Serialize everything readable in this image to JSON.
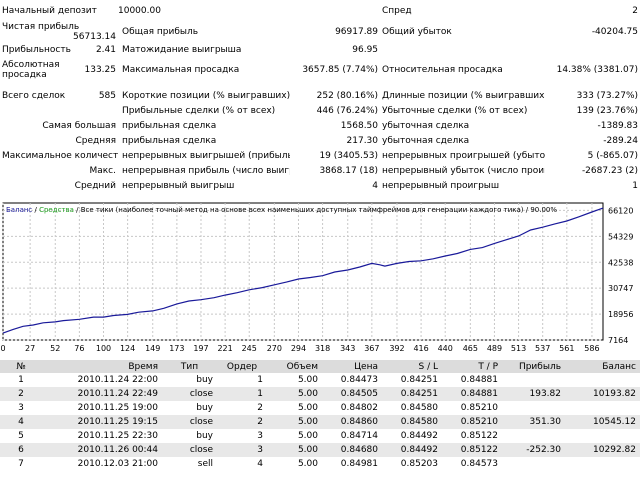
{
  "summary": {
    "initial_deposit_label": "Начальный депозит",
    "initial_deposit_value": "10000.00",
    "spread_label": "Спред",
    "spread_value": "2",
    "net_profit_label": "Чистая прибыль",
    "net_profit_value": "56713.14",
    "gross_profit_label": "Общая прибыль",
    "gross_profit_value": "96917.89",
    "gross_loss_label": "Общий убыток",
    "gross_loss_value": "-40204.75",
    "profit_factor_label": "Прибыльность",
    "profit_factor_value": "2.41",
    "expected_payoff_label": "Матожидание выигрыша",
    "expected_payoff_value": "96.95",
    "abs_drawdown_label": "Абсолютная просадка",
    "abs_drawdown_value": "133.25",
    "max_drawdown_label": "Максимальная просадка",
    "max_drawdown_value": "3657.85 (7.74%)",
    "rel_drawdown_label": "Относительная просадка",
    "rel_drawdown_value": "14.38% (3381.07)",
    "total_trades_label": "Всего сделок",
    "total_trades_value": "585",
    "short_label": "Короткие позиции (% выигравших)",
    "short_value": "252 (80.16%)",
    "long_label": "Длинные позиции (% выигравших)",
    "long_value": "333 (73.27%)",
    "profit_trades_label": "Прибыльные сделки (% от всех)",
    "profit_trades_value": "446 (76.24%)",
    "loss_trades_label": "Убыточные сделки (% от всех)",
    "loss_trades_value": "139 (23.76%)",
    "largest_label": "Самая большая",
    "largest_profit_label": "прибыльная сделка",
    "largest_profit_value": "1568.50",
    "largest_loss_label": "убыточная сделка",
    "largest_loss_value": "-1389.83",
    "average_label": "Средняя",
    "average_profit_label": "прибыльная сделка",
    "average_profit_value": "217.30",
    "average_loss_label": "убыточная сделка",
    "average_loss_value": "-289.24",
    "max_count_label": "Максимальное количество",
    "max_cons_wins_label": "непрерывных выигрышей (прибыль)",
    "max_cons_wins_value": "19 (3405.53)",
    "max_cons_losses_label": "непрерывных проигрышей (убыток)",
    "max_cons_losses_value": "5 (-865.07)",
    "max_label": "Макс.",
    "max_cons_profit_label": "непрерывная прибыль (число выигрышей)",
    "max_cons_profit_value": "3868.17 (18)",
    "max_cons_loss_label": "непрерывный убыток (число проигрышей)",
    "max_cons_loss_value": "-2687.23 (2)",
    "avg_label": "Средний",
    "avg_cons_wins_label": "непрерывный выигрыш",
    "avg_cons_wins_value": "4",
    "avg_cons_losses_label": "непрерывный проигрыш",
    "avg_cons_losses_value": "1"
  },
  "chart_data": {
    "type": "line",
    "legend": {
      "balance": "Баланс",
      "sep1": " / ",
      "equity": "Средства",
      "sep2": " / ",
      "desc": "Все тики (наиболее точный метод на основе всех наименьших доступных таймфреймов для генерации каждого тика)",
      "sep3": " / ",
      "quality": "90.00%"
    },
    "x_ticks": [
      "0",
      "27",
      "52",
      "76",
      "100",
      "124",
      "149",
      "173",
      "197",
      "221",
      "245",
      "270",
      "294",
      "318",
      "343",
      "367",
      "392",
      "416",
      "440",
      "465",
      "489",
      "513",
      "537",
      "561",
      "586"
    ],
    "y_ticks": [
      "66120",
      "54329",
      "42538",
      "30747",
      "18956",
      "7164"
    ],
    "xlim": [
      0,
      597
    ],
    "ylim": [
      7164,
      69500
    ],
    "series": [
      {
        "name": "Баланс",
        "color": "#1a1a9a",
        "x": [
          0,
          10,
          20,
          30,
          40,
          52,
          60,
          76,
          90,
          100,
          110,
          124,
          135,
          149,
          160,
          173,
          185,
          197,
          210,
          221,
          233,
          245,
          258,
          270,
          282,
          294,
          306,
          318,
          330,
          343,
          355,
          367,
          375,
          380,
          392,
          404,
          416,
          428,
          440,
          452,
          465,
          477,
          489,
          501,
          513,
          525,
          537,
          549,
          561,
          573,
          586,
          597
        ],
        "y": [
          10300,
          12000,
          13400,
          14000,
          15000,
          15400,
          16000,
          16600,
          17600,
          17600,
          18300,
          18800,
          19800,
          20400,
          21600,
          23600,
          24900,
          25500,
          26400,
          27600,
          28700,
          30000,
          31000,
          32300,
          33500,
          34900,
          35600,
          36400,
          38100,
          39000,
          40400,
          42000,
          41400,
          40800,
          42000,
          42900,
          43200,
          44100,
          45400,
          46500,
          48400,
          49200,
          51100,
          52800,
          54500,
          57200,
          58500,
          60000,
          61300,
          63200,
          65400,
          67200
        ]
      }
    ]
  },
  "trades": {
    "headers": [
      "№",
      "Время",
      "Тип",
      "Ордер",
      "Объем",
      "Цена",
      "S / L",
      "T / P",
      "Прибыль",
      "Баланс"
    ],
    "rows": [
      [
        "1",
        "2010.11.24 22:00",
        "buy",
        "1",
        "5.00",
        "0.84473",
        "0.84251",
        "0.84881",
        "",
        ""
      ],
      [
        "2",
        "2010.11.24 22:49",
        "close",
        "1",
        "5.00",
        "0.84505",
        "0.84251",
        "0.84881",
        "193.82",
        "10193.82"
      ],
      [
        "3",
        "2010.11.25 19:00",
        "buy",
        "2",
        "5.00",
        "0.84802",
        "0.84580",
        "0.85210",
        "",
        ""
      ],
      [
        "4",
        "2010.11.25 19:15",
        "close",
        "2",
        "5.00",
        "0.84860",
        "0.84580",
        "0.85210",
        "351.30",
        "10545.12"
      ],
      [
        "5",
        "2010.11.25 22:30",
        "buy",
        "3",
        "5.00",
        "0.84714",
        "0.84492",
        "0.85122",
        "",
        ""
      ],
      [
        "6",
        "2010.11.26 00:44",
        "close",
        "3",
        "5.00",
        "0.84680",
        "0.84492",
        "0.85122",
        "-252.30",
        "10292.82"
      ],
      [
        "7",
        "2010.12.03 21:00",
        "sell",
        "4",
        "5.00",
        "0.84981",
        "0.85203",
        "0.84573",
        "",
        ""
      ]
    ]
  }
}
